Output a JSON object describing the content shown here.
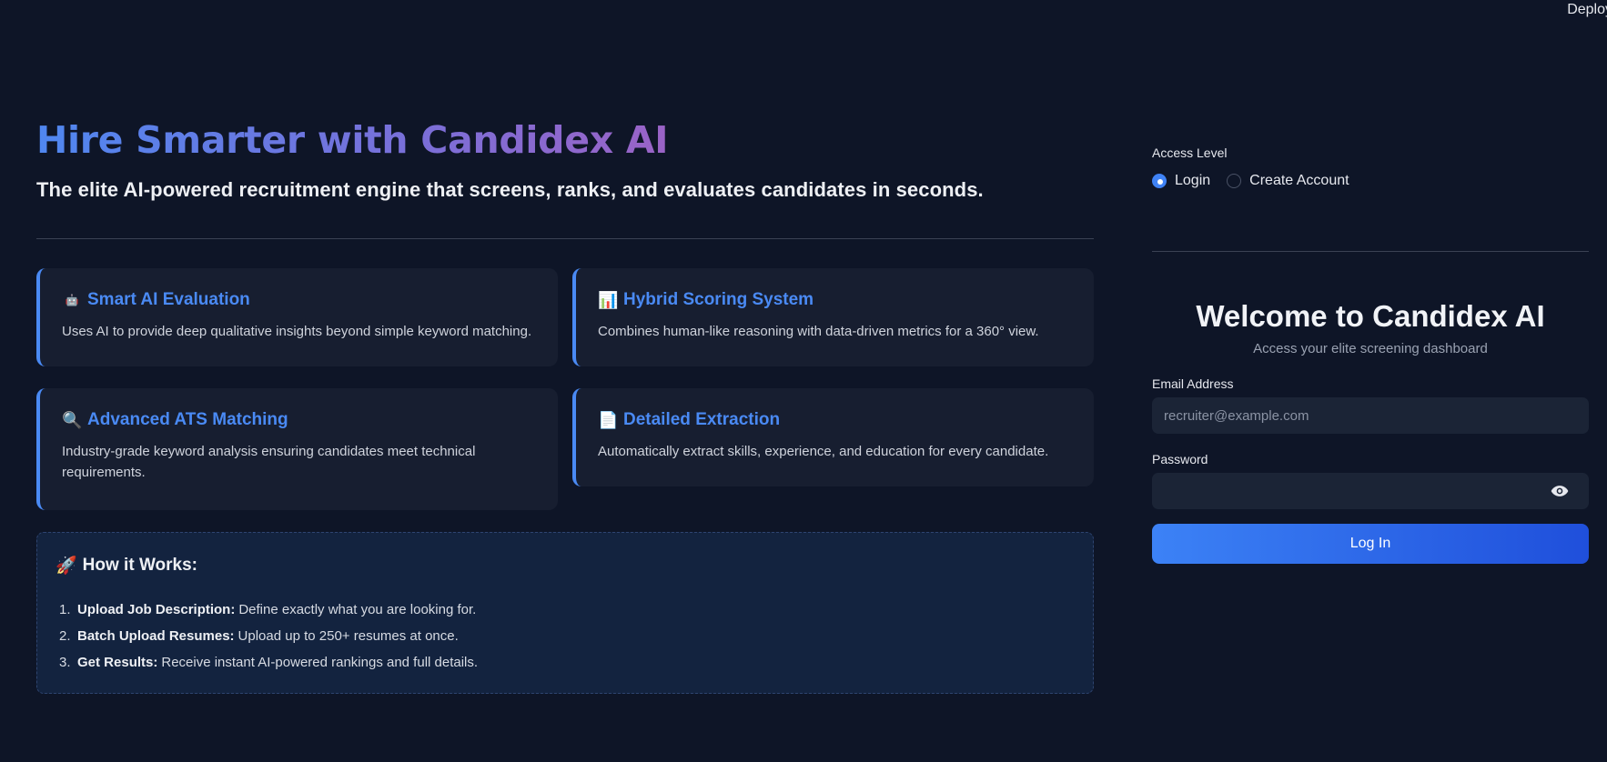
{
  "topbar": {
    "deploy_label": "Deploy"
  },
  "hero": {
    "title": "Hire Smarter with Candidex AI",
    "subtitle": "The elite AI-powered recruitment engine that screens, ranks, and evaluates candidates in seconds."
  },
  "features": [
    {
      "icon": "robot-icon",
      "glyph": "🤖",
      "title": "Smart AI Evaluation",
      "description": "Uses AI to provide deep qualitative insights beyond simple keyword matching."
    },
    {
      "icon": "bar-chart-icon",
      "glyph": "📊",
      "title": "Hybrid Scoring System",
      "description": "Combines human-like reasoning with data-driven metrics for a 360° view."
    },
    {
      "icon": "magnifier-icon",
      "glyph": "🔍",
      "title": "Advanced ATS Matching",
      "description": "Industry-grade keyword analysis ensuring candidates meet technical requirements."
    },
    {
      "icon": "document-icon",
      "glyph": "📄",
      "title": "Detailed Extraction",
      "description": "Automatically extract skills, experience, and education for every candidate."
    }
  ],
  "how": {
    "icon": "rocket-icon",
    "glyph": "🚀",
    "title": "How it Works:",
    "steps": [
      {
        "num": "1.",
        "bold": "Upload Job Description:",
        "text": "Define exactly what you are looking for."
      },
      {
        "num": "2.",
        "bold": "Batch Upload Resumes:",
        "text": "Upload up to 250+ resumes at once."
      },
      {
        "num": "3.",
        "bold": "Get Results:",
        "text": "Receive instant AI-powered rankings and full details."
      }
    ]
  },
  "auth": {
    "access_label": "Access Level",
    "options": [
      {
        "label": "Login",
        "selected": true
      },
      {
        "label": "Create Account",
        "selected": false
      }
    ],
    "welcome_title": "Welcome to Candidex AI",
    "welcome_sub": "Access your elite screening dashboard",
    "email_label": "Email Address",
    "email_placeholder": "recruiter@example.com",
    "email_value": "",
    "password_label": "Password",
    "password_value": "",
    "submit_label": "Log In"
  },
  "colors": {
    "background": "#0e1527",
    "accent": "#4a8af4",
    "card": "#171e30"
  }
}
